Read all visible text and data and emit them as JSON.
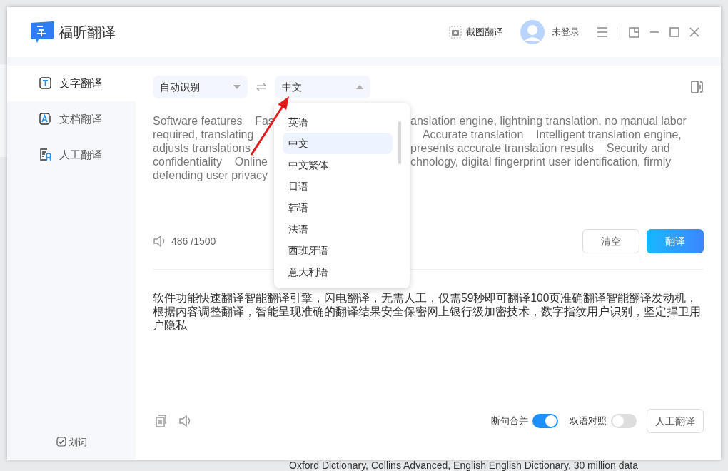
{
  "app": {
    "name": "福昕翻译"
  },
  "header": {
    "screenshot_button": "截图翻译",
    "user": "未登录"
  },
  "sidebar": {
    "items": [
      {
        "label": "文字翻译",
        "kind": "text",
        "selected": true
      },
      {
        "label": "文档翻译",
        "kind": "document",
        "selected": false
      },
      {
        "label": "人工翻译",
        "kind": "human",
        "selected": false
      }
    ],
    "word_pick": {
      "label": "划词",
      "checked": true
    }
  },
  "source_language": {
    "value": "自动识别",
    "expanded": false
  },
  "target_language": {
    "value": "中文",
    "expanded": true
  },
  "language_menu": [
    {
      "label": "英语",
      "selected": false
    },
    {
      "label": "中文",
      "selected": true
    },
    {
      "label": "中文繁体",
      "selected": false
    },
    {
      "label": "日语",
      "selected": false
    },
    {
      "label": "韩语",
      "selected": false
    },
    {
      "label": "法语",
      "selected": false
    },
    {
      "label": "西班牙语",
      "selected": false
    },
    {
      "label": "意大利语",
      "selected": false
    }
  ],
  "source_text_lines": [
    {
      "left": "Software features    Fas",
      "right": "anslation engine, lightning translation, no manual labor"
    },
    {
      "left": "required, translating",
      "right": "    Accurate translation    Intelligent translation engine,"
    },
    {
      "left": "adjusts translations",
      "right": "presents accurate translation results    Security and"
    },
    {
      "left": "confidentiality    Online",
      "right": "chnology, digital fingerprint user identification, firmly"
    },
    {
      "left": "defending user privacy"
    }
  ],
  "char_count": "486 /1500",
  "buttons": {
    "clear": "清空",
    "translate": "翻译"
  },
  "result_text": "软件功能快速翻译智能翻译引擎，闪电翻译，无需人工，仅需59秒即可翻译100页准确翻译智能翻译发动机，根据内容调整翻译，智能呈现准确的翻译结果安全保密网上银行级加密技术，数字指纹用户识别，坚定捍卫用户隐私",
  "toggles": [
    {
      "label": "断句合并",
      "on": true
    },
    {
      "label": "双语对照",
      "on": false
    }
  ],
  "human_translate_button": "人工翻译",
  "background_text": "Oxford Dictionary, Collins Advanced, English English Dictionary, 30 million data"
}
